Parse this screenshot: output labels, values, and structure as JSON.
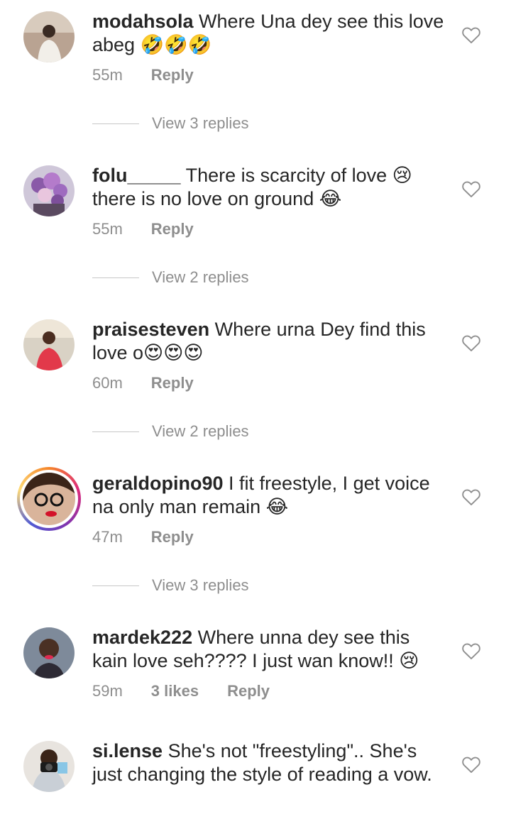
{
  "comments": [
    {
      "username": "modahsola",
      "text": "Where Una dey see this love abeg 🤣🤣🤣",
      "time": "55m",
      "reply": "Reply",
      "view_replies": "View 3 replies"
    },
    {
      "username": "folu_____",
      "text": "There is scarcity of love 😢 there is no love on ground 😂",
      "time": "55m",
      "reply": "Reply",
      "view_replies": "View 2 replies"
    },
    {
      "username": "praisesteven",
      "text": "Where urna Dey find this love o😍😍😍",
      "time": "60m",
      "reply": "Reply",
      "view_replies": "View 2 replies"
    },
    {
      "username": "geraldopino90",
      "text": "I fit freestyle, I get voice na only man remain 😂",
      "time": "47m",
      "reply": "Reply",
      "view_replies": "View 3 replies"
    },
    {
      "username": "mardek222",
      "text": "Where unna dey see this kain love seh???? I just wan know!! 😢",
      "time": "59m",
      "likes": "3 likes",
      "reply": "Reply"
    },
    {
      "username": "si.lense",
      "text": "She's not \"freestyling\".. She's just changing the style of reading a vow."
    }
  ],
  "icons": {
    "like": "heart-outline-icon"
  },
  "colors": {
    "text": "#262626",
    "muted": "#8e8e8e",
    "divider": "#c7c7c7"
  }
}
